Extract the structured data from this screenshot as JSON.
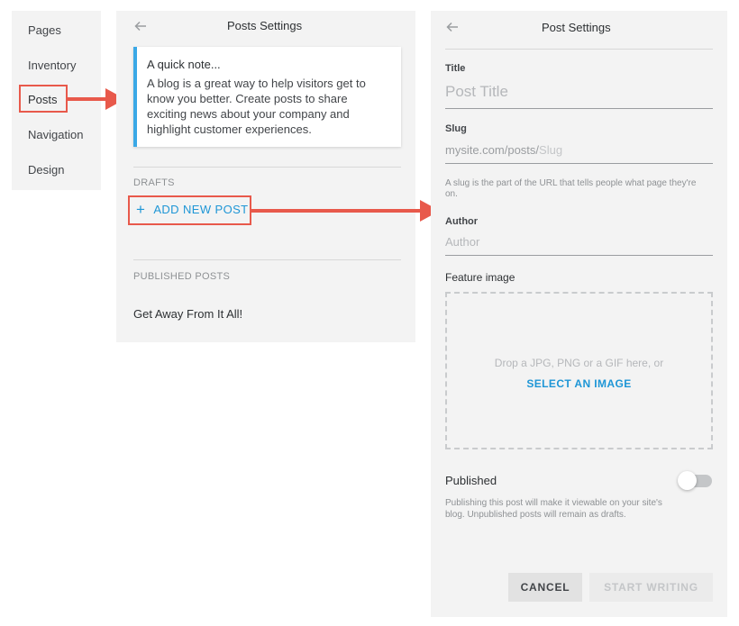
{
  "nav": {
    "items": [
      {
        "label": "Pages"
      },
      {
        "label": "Inventory"
      },
      {
        "label": "Posts"
      },
      {
        "label": "Navigation"
      },
      {
        "label": "Design"
      }
    ],
    "active": "Posts"
  },
  "posts_settings": {
    "title": "Posts Settings",
    "note": {
      "title": "A quick note...",
      "body": "A blog is a great way to help visitors get to know you better. Create posts to share exciting news about your company and highlight customer experiences."
    },
    "drafts_label": "DRAFTS",
    "add_new_post_label": "ADD NEW POST",
    "published_label": "PUBLISHED POSTS",
    "published_posts": [
      "Get Away From It All!"
    ]
  },
  "post_settings": {
    "title": "Post Settings",
    "title_field": {
      "label": "Title",
      "placeholder": "Post Title"
    },
    "slug_field": {
      "label": "Slug",
      "prefix": "mysite.com/posts/",
      "placeholder": "Slug",
      "help": "A slug is the part of the URL that tells people what page they're on."
    },
    "author_field": {
      "label": "Author",
      "placeholder": "Author"
    },
    "feature_image": {
      "label": "Feature image",
      "drop_text": "Drop a JPG, PNG or a GIF here, or",
      "select_label": "SELECT AN IMAGE"
    },
    "published": {
      "label": "Published",
      "on": false,
      "help": "Publishing this post will make it viewable on your site's blog. Unpublished posts will remain as drafts."
    },
    "cancel_label": "CANCEL",
    "start_label": "START WRITING"
  },
  "colors": {
    "accent": "#1e96d6",
    "annotation": "#e8594b",
    "note_border": "#3aa8e6",
    "panel_bg": "#f3f3f3"
  },
  "icons": {
    "back": "arrow-left-icon",
    "add": "plus-icon"
  }
}
